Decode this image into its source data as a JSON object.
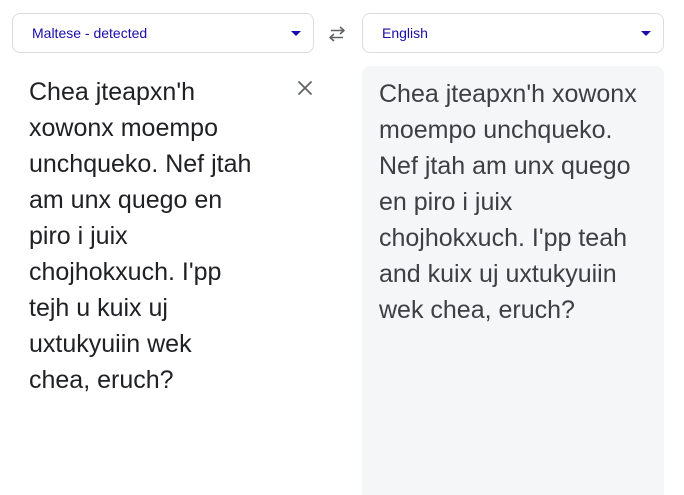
{
  "source": {
    "language_label": "Maltese - detected",
    "text": "Chea jteapxn'h xowonx moempo unchqueko. Nef jtah am unx quego en piro i juix chojhokxuch. I'pp tejh u kuix uj uxtukyuiin wek chea, eruch?"
  },
  "target": {
    "language_label": "English",
    "text": "Chea jteapxn'h xowonx moempo unchqueko. Nef jtah am unx quego en piro i juix chojhokxuch. I'pp teah and kuix uj uxtukyuiin wek chea, eruch?"
  },
  "icons": {
    "swap": "swap-languages-icon",
    "clear": "close-icon",
    "dropdown": "chevron-down-icon"
  },
  "colors": {
    "accent": "#1a0dab",
    "source_text": "#202124",
    "target_text": "#3c4043",
    "target_background": "#f5f6f7",
    "border": "#dadce0"
  }
}
